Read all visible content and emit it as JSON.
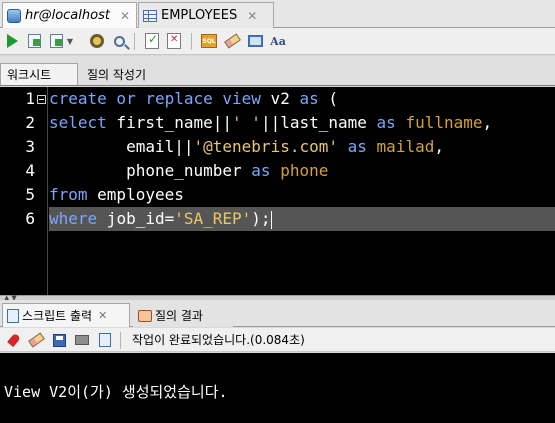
{
  "doc_tabs": [
    {
      "label": "hr@localhost",
      "icon": "database-connection-icon",
      "active": true
    },
    {
      "label": "EMPLOYEES",
      "icon": "table-icon",
      "active": false
    }
  ],
  "worksheet_tabs": [
    {
      "label": "워크시트",
      "active": true
    },
    {
      "label": "질의 작성기",
      "active": false
    }
  ],
  "editor": {
    "line_numbers": [
      "1",
      "2",
      "3",
      "4",
      "5",
      "6"
    ],
    "current_line": 6,
    "tokens": {
      "l1": {
        "a": "create or replace view",
        "b": " v2 ",
        "c": "as",
        "d": " ("
      },
      "l2": {
        "a": "select",
        "b": " first_name||",
        "c": "' '",
        "d": "||last_name ",
        "e": "as",
        "f": " ",
        "g": "fullname",
        "h": ","
      },
      "l3": {
        "a": "        email||",
        "b": "'@tenebris.com'",
        "c": " ",
        "d": "as",
        "e": " ",
        "f": "mailad",
        "g": ","
      },
      "l4": {
        "a": "        phone_number ",
        "b": "as",
        "c": " ",
        "d": "phone"
      },
      "l5": {
        "a": "from",
        "b": " employees"
      },
      "l6": {
        "a": "where",
        "b": " job_id=",
        "c": "'SA_REP'",
        "d": ");"
      }
    }
  },
  "result_tabs": [
    {
      "label": "스크립트 출력",
      "active": true
    },
    {
      "label": "질의 결과",
      "active": false
    }
  ],
  "result_status": "작업이 완료되었습니다.(0.084초)",
  "output_text": "View V2이(가) 생성되었습니다.",
  "colors": {
    "keyword": "#7aa6ff",
    "string": "#e8c76b",
    "alias": "#d4a23a",
    "editor_bg": "#000000",
    "current_line": "#555555"
  }
}
